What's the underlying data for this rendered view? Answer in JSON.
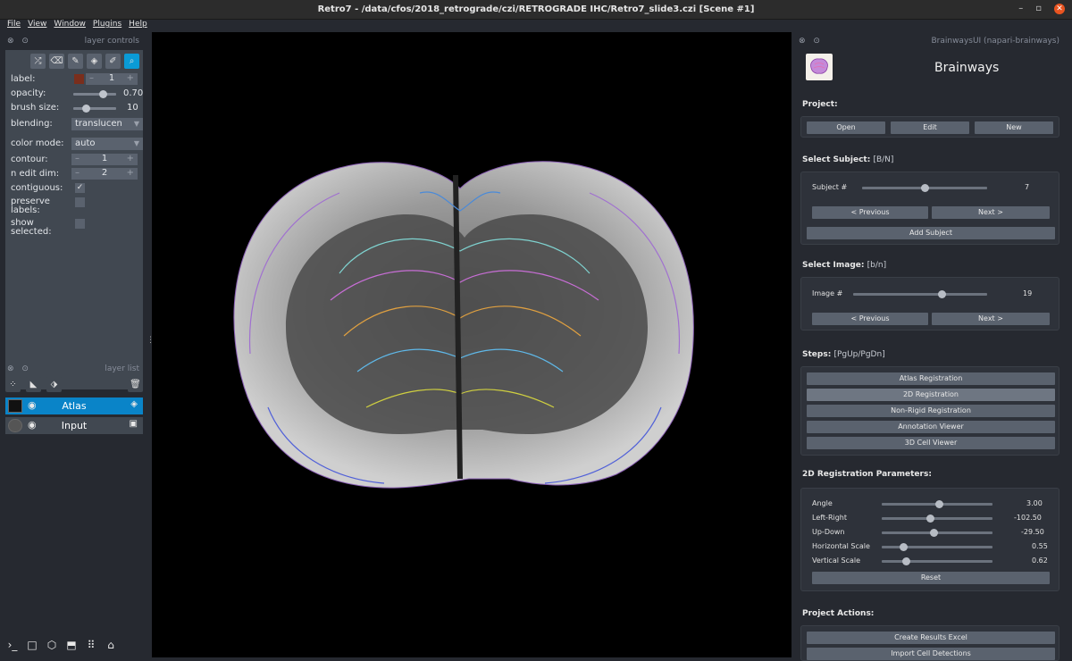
{
  "window": {
    "title": "Retro7 - /data/cfos/2018_retrograde/czi/RETROGRADE IHC/Retro7_slide3.czi [Scene #1]",
    "controls": [
      "–",
      "▫",
      "✕"
    ]
  },
  "menu": [
    "File",
    "View",
    "Window",
    "Plugins",
    "Help"
  ],
  "layer_controls": {
    "dock_title": "layer controls",
    "dock_ctl": "⊗ ⊙",
    "tools": [
      {
        "icon": "shuffle-icon",
        "glyph": "⤮"
      },
      {
        "icon": "eraser-icon",
        "glyph": "⌫"
      },
      {
        "icon": "pencil-icon",
        "glyph": "✎"
      },
      {
        "icon": "fill-icon",
        "glyph": "◈"
      },
      {
        "icon": "eyedropper-icon",
        "glyph": "✐"
      },
      {
        "icon": "zoom-icon",
        "glyph": "⌕"
      }
    ],
    "label_label": "label:",
    "label_value": "1",
    "label_color": "#7a2e1c",
    "opacity_label": "opacity:",
    "opacity_value": "0.70",
    "opacity_fraction": 0.7,
    "brush_label": "brush size:",
    "brush_value": "10",
    "brush_fraction": 0.3,
    "blending_label": "blending:",
    "blending_value": "translucen",
    "colormode_label": "color mode:",
    "colormode_value": "auto",
    "contour_label": "contour:",
    "contour_value": "1",
    "ndim_label": "n edit dim:",
    "ndim_value": "2",
    "contiguous_label": "contiguous:",
    "contiguous_check": "✓",
    "preserve_label": "preserve labels:",
    "show_label": "show selected:"
  },
  "layer_list": {
    "dock_title": "layer list",
    "dock_ctl": "⊗ ⊙",
    "layers": [
      {
        "name": "Atlas",
        "type_icon": "◈",
        "eye": "◉",
        "selected": true
      },
      {
        "name": "Input",
        "type_icon": "▣",
        "eye": "◉",
        "selected": false
      }
    ]
  },
  "console_icons": [
    "›_",
    "□",
    "⬡",
    "⬒",
    "⠿",
    "⌂"
  ],
  "panel": {
    "dock_title": "BrainwaysUI (napari-brainways)",
    "dock_ctl": "⊗ ⊙",
    "app_title": "Brainways",
    "project_label": "Project:",
    "project_buttons": [
      "Open",
      "Edit",
      "New"
    ],
    "subject_label": "Select Subject:",
    "subject_keys": "[B/N]",
    "subject_row_label": "Subject #",
    "subject_value": "7",
    "subject_fraction": 0.5,
    "prev_label": "< Previous",
    "next_label": "Next >",
    "add_subject": "Add Subject",
    "image_label": "Select Image:",
    "image_keys": "[b/n]",
    "image_row_label": "Image #",
    "image_value": "19",
    "image_fraction": 0.66,
    "steps_label": "Steps:",
    "steps_keys": "[PgUp/PgDn]",
    "steps": [
      "Atlas Registration",
      "2D Registration",
      "Non-Rigid Registration",
      "Annotation Viewer",
      "3D Cell Viewer"
    ],
    "params_label": "2D Registration Parameters:",
    "params": [
      {
        "label": "Angle",
        "value": "3.00",
        "fraction": 0.52
      },
      {
        "label": "Left-Right",
        "value": "-102.50",
        "fraction": 0.44
      },
      {
        "label": "Up-Down",
        "value": "-29.50",
        "fraction": 0.47
      },
      {
        "label": "Horizontal Scale",
        "value": "0.55",
        "fraction": 0.2
      },
      {
        "label": "Vertical Scale",
        "value": "0.62",
        "fraction": 0.22
      }
    ],
    "reset_label": "Reset",
    "actions_label": "Project Actions:",
    "actions": [
      "Create Results Excel",
      "Import Cell Detections"
    ]
  }
}
